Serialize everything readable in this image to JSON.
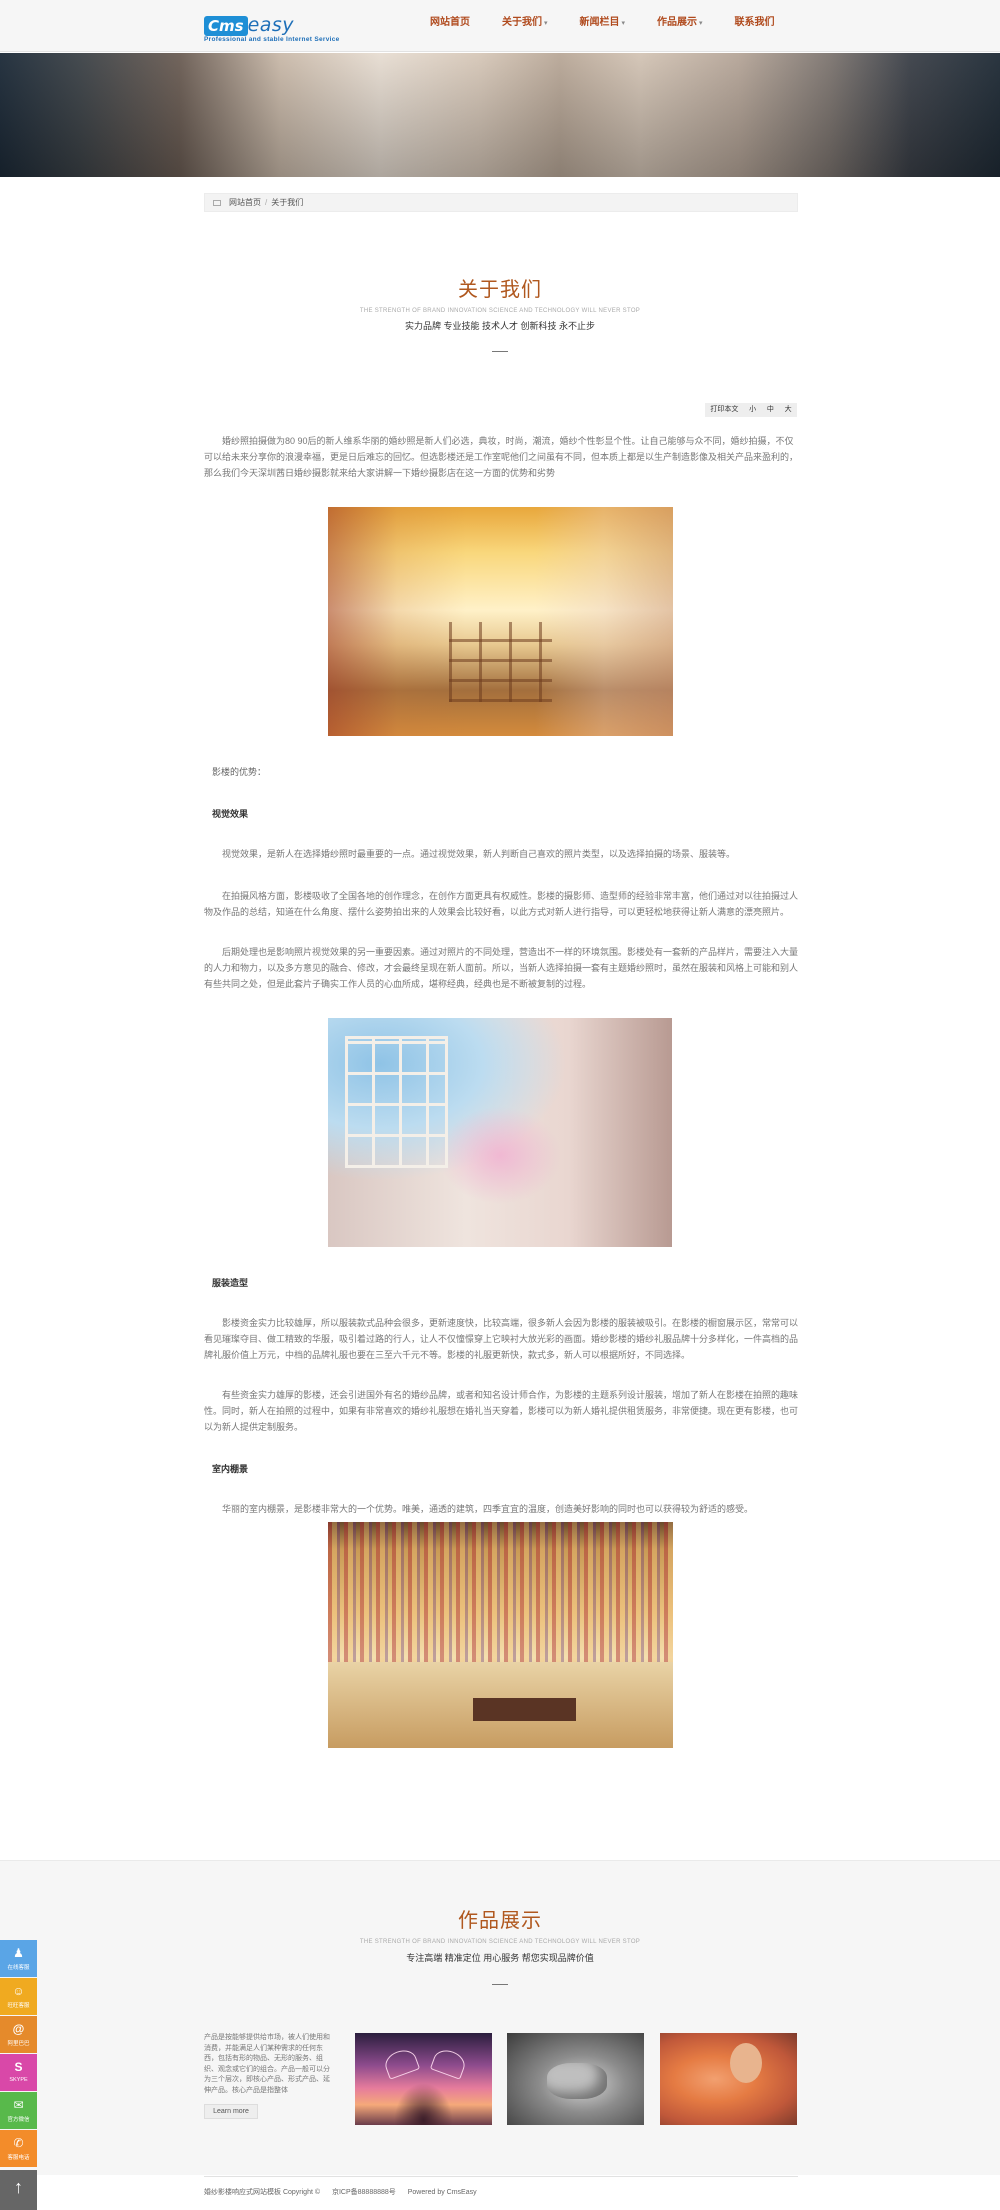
{
  "logo": {
    "word1": "Cms",
    "word2": "easy",
    "tagline": "Professional and stable Internet Service"
  },
  "nav": [
    {
      "label": "网站首页",
      "caret": ""
    },
    {
      "label": "关于我们",
      "caret": "▾"
    },
    {
      "label": "新闻栏目",
      "caret": "▾"
    },
    {
      "label": "作品展示",
      "caret": "▾"
    },
    {
      "label": "联系我们",
      "caret": ""
    }
  ],
  "breadcrumb": {
    "home": "网站首页",
    "sep": "/",
    "current": "关于我们"
  },
  "about": {
    "title": "关于我们",
    "en": "THE STRENGTH OF BRAND INNOVATION SCIENCE AND TECHNOLOGY WILL NEVER STOP",
    "sub": "实力品牌 专业技能 技术人才 创新科技 永不止步"
  },
  "tools": {
    "print": "打印本文",
    "small": "小",
    "medium": "中",
    "large": "大"
  },
  "article": {
    "intro": "婚纱照拍摄做为80 90后的新人维系华丽的婚纱照是新人们必选，典妆，时尚，潮流，婚纱个性彰显个性。让自己能够与众不同，婚纱拍摄，不仅可以给未来分享你的浪漫幸福，更是日后难忘的回忆。但选影楼还是工作室呢他们之间虽有不同，但本质上都是以生产制造影像及相关产品来盈利的，那么我们今天深圳茜日婚纱摄影就来给大家讲解一下婚纱摄影店在这一方面的优势和劣势",
    "advantages": "影楼的优势：",
    "h1": "视觉效果",
    "p1": "视觉效果，是新人在选择婚纱照时最重要的一点。通过视觉效果，新人判断自己喜欢的照片类型，以及选择拍摄的场景、服装等。",
    "p2": "在拍摄风格方面，影楼吸收了全国各地的创作理念，在创作方面更具有权威性。影楼的摄影师、造型师的经验非常丰富，他们通过对以往拍摄过人物及作品的总结，知道在什么角度、摆什么姿势拍出来的人效果会比较好看，以此方式对新人进行指导，可以更轻松地获得让新人满意的漂亮照片。",
    "p3": "后期处理也是影响照片视觉效果的另一重要因素。通过对照片的不同处理，营造出不一样的环境氛围。影楼处有一套新的产品样片，需要注入大量的人力和物力，以及多方意见的融合、修改，才会最终呈现在新人面前。所以，当新人选择拍摄一套有主题婚纱照时，虽然在服装和风格上可能和别人有些共同之处，但是此套片子确实工作人员的心血所成，堪称经典，经典也是不断被复制的过程。",
    "h2": "服装造型",
    "p4": "影楼资金实力比较雄厚，所以服装款式品种会很多，更新速度快，比较高端，很多新人会因为影楼的服装被吸引。在影楼的橱窗展示区，常常可以看见璀璨夺目、做工精致的华服，吸引着过路的行人，让人不仅憧憬穿上它映衬大放光彩的画面。婚纱影楼的婚纱礼服品牌十分多样化，一件高档的品牌礼服价值上万元，中档的品牌礼服也要在三至六千元不等。影楼的礼服更新快，款式多，新人可以根据所好，不同选择。",
    "p5": "有些资金实力雄厚的影楼，还会引进国外有名的婚纱品牌，或者和知名设计师合作，为影楼的主题系列设计服装，增加了新人在影楼在拍照的趣味性。同时，新人在拍照的过程中，如果有非常喜欢的婚纱礼服想在婚礼当天穿着，影楼可以为新人婚礼提供租赁服务，非常便捷。现在更有影楼，也可以为新人提供定制服务。",
    "h3": "室内棚景",
    "p6": "华丽的室内棚景，是影楼非常大的一个优势。唯美，通透的建筑，四季宜宜的温度，创造美好影响的同时也可以获得较为舒适的感受。"
  },
  "works": {
    "title": "作品展示",
    "en": "THE STRENGTH OF BRAND INNOVATION SCIENCE AND TECHNOLOGY WILL NEVER STOP",
    "sub": "专注高端 精准定位 用心服务 帮您实现品牌价值",
    "desc": "产品是按能够提供给市场，被人们使用和消费，并能满足人们某种需求的任何东西，包括有形的物品、无形的服务、组织、观念或它们的组合。产品一般可以分为三个层次，即核心产品、形式产品、延伸产品。核心产品是指整体",
    "learn_more": "Learn more"
  },
  "footer": {
    "copyright": "婚纱影楼响应式网站模板 Copyright ©",
    "icp": "京ICP备88888888号",
    "powered": "Powered by CmsEasy"
  },
  "sidebar": [
    {
      "icon": "qq-icon",
      "glyph": "♟",
      "label": "在线客服"
    },
    {
      "icon": "wangwang-icon",
      "glyph": "☺",
      "label": "旺旺客服"
    },
    {
      "icon": "alibaba-icon",
      "glyph": "@",
      "label": "阿里巴巴"
    },
    {
      "icon": "skype-icon",
      "glyph": "S",
      "label": "SKYPE"
    },
    {
      "icon": "wechat-icon",
      "glyph": "✉",
      "label": "官方微信"
    },
    {
      "icon": "phone-icon",
      "glyph": "✆",
      "label": "客服电话"
    },
    {
      "icon": "back-to-top-icon",
      "glyph": "↑",
      "label": ""
    }
  ]
}
